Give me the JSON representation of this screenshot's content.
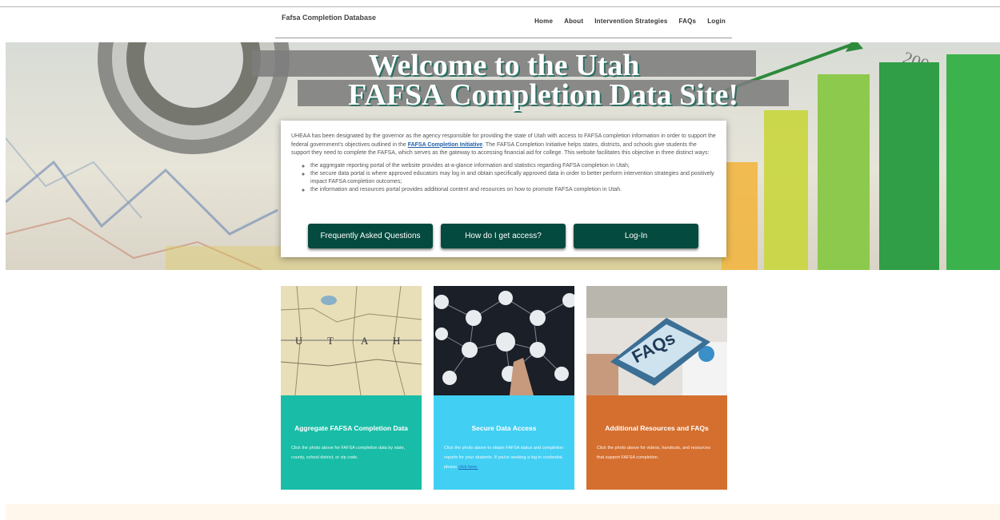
{
  "header": {
    "brand": "Fafsa Completion Database",
    "nav": [
      "Home",
      "About",
      "Intervention Strategies",
      "FAQs",
      "Login"
    ]
  },
  "hero": {
    "title_line1": "Welcome to the Utah",
    "title_line2": "FAFSA Completion Data Site!"
  },
  "info": {
    "intro_before": "UHEAA has been designated by the governor as the agency responsible for providing the state of Utah with access to FAFSA completion information in order to support the federal government's objectives outlined in the ",
    "intro_link": "FAFSA Completion Initiative",
    "intro_after": ". The FAFSA Completion Initiative helps states, districts, and schools give students the support they need to complete the FAFSA, which serves as the gateway to accessing financial aid for college. This website facilitates this objective in three distinct ways:",
    "ways": [
      "the aggregate reporting portal of the website provides at-a-glance information and statistics regarding FAFSA completion in Utah;",
      "the secure data portal is where approved educators may log in and obtain specifically approved data in order to better perform intervention strategies and positively impact FAFSA completion outcomes;",
      "the information and resources portal provides additional content and resources on how to promote FAFSA completion in Utah."
    ],
    "buttons": [
      "Frequently Asked Questions",
      "How do I get access?",
      "Log-In"
    ]
  },
  "cards": [
    {
      "title": "Aggregate FAFSA Completion Data",
      "text": "Click the photo above for FAFSA completion data by state, county, school district, or zip code.",
      "color": "#19bda7"
    },
    {
      "title": "Secure Data Access",
      "text": "Click the photo above to obtain FAFSA status and completion reports for your students. If you're seeking a log-in credential, please ",
      "link": "click here.",
      "color": "#42cff4"
    },
    {
      "title": "Additional Resources and FAQs",
      "text": "Click the photo above for videos, handouts, and resources that support FAFSA completion.",
      "color": "#d56f2f"
    }
  ],
  "images": {
    "map_letters": [
      "U",
      "T",
      "A",
      "H"
    ],
    "faq_sign": "FAQs",
    "chart_axis_label": "200"
  }
}
